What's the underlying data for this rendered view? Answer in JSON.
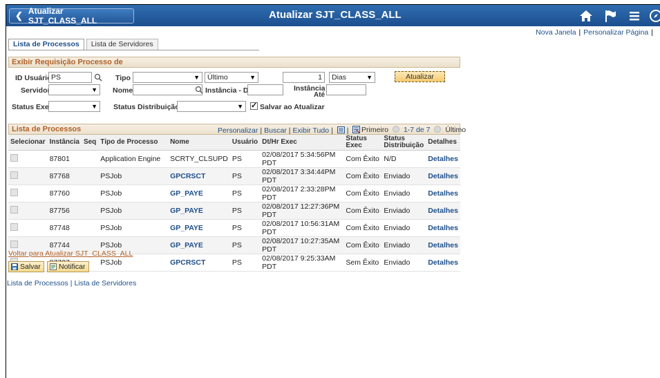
{
  "header": {
    "back_label": "Atualizar SJT_CLASS_ALL",
    "title": "Atualizar SJT_CLASS_ALL"
  },
  "top_links": {
    "new_window": "Nova Janela",
    "personalize": "Personalizar Página"
  },
  "tabs": [
    {
      "label": "Lista de Processos",
      "active": true
    },
    {
      "label": "Lista de Servidores",
      "active": false
    }
  ],
  "request": {
    "section_title": "Exibir Requisição Processo de",
    "user_id_label": "ID Usuário",
    "user_id_value": "PS",
    "type_label": "Tipo",
    "type_value": "",
    "last_value": "Último",
    "count_value": "1",
    "unit_value": "Dias",
    "refresh_label": "Atualizar",
    "server_label": "Servidor",
    "server_value": "",
    "name_label": "Nome",
    "name_value": "",
    "instance_from_label": "Instância - De",
    "instance_from_value": "",
    "instance_to_label_1": "Instância -",
    "instance_to_label_2": "Até",
    "instance_to_value": "",
    "run_status_label": "Status Exec",
    "run_status_value": "",
    "dist_status_label": "Status Distribuição",
    "dist_status_value": "",
    "save_on_refresh_label": "Salvar ao Atualizar",
    "save_on_refresh_checked": true
  },
  "grid": {
    "title": "Lista de Processos",
    "link_personalize": "Personalizar",
    "link_find": "Buscar",
    "link_view_all": "Exibir Tudo",
    "nav_first": "Primeiro",
    "nav_range": "1-7 de 7",
    "nav_last": "Último",
    "columns": [
      "Selecionar",
      "Instância",
      "Seq",
      "Tipo de Processo",
      "Nome",
      "Usuário",
      "Dt/Hr Exec",
      "Status Exec",
      "Status Distribuição",
      "Detalhes"
    ],
    "rows": [
      {
        "instance": "87801",
        "seq": "",
        "type": "Application Engine",
        "name": "SCRTY_CLSUPD",
        "name_link": false,
        "user": "PS",
        "datetime": "02/08/2017  5:34:56PM PDT",
        "run_status": "Com Êxito",
        "dist_status": "N/D",
        "details": "Detalhes"
      },
      {
        "instance": "87768",
        "seq": "",
        "type": "PSJob",
        "name": "GPCRSCT",
        "name_link": true,
        "user": "PS",
        "datetime": "02/08/2017  3:34:44PM PDT",
        "run_status": "Com Êxito",
        "dist_status": "Enviado",
        "details": "Detalhes"
      },
      {
        "instance": "87760",
        "seq": "",
        "type": "PSJob",
        "name": "GP_PAYE",
        "name_link": true,
        "user": "PS",
        "datetime": "02/08/2017  2:33:28PM PDT",
        "run_status": "Com Êxito",
        "dist_status": "Enviado",
        "details": "Detalhes"
      },
      {
        "instance": "87756",
        "seq": "",
        "type": "PSJob",
        "name": "GP_PAYE",
        "name_link": true,
        "user": "PS",
        "datetime": "02/08/2017 12:27:36PM PDT",
        "run_status": "Com Êxito",
        "dist_status": "Enviado",
        "details": "Detalhes"
      },
      {
        "instance": "87748",
        "seq": "",
        "type": "PSJob",
        "name": "GP_PAYE",
        "name_link": true,
        "user": "PS",
        "datetime": "02/08/2017 10:56:31AM PDT",
        "run_status": "Com Êxito",
        "dist_status": "Enviado",
        "details": "Detalhes"
      },
      {
        "instance": "87744",
        "seq": "",
        "type": "PSJob",
        "name": "GP_PAYE",
        "name_link": true,
        "user": "PS",
        "datetime": "02/08/2017 10:27:35AM PDT",
        "run_status": "Com Êxito",
        "dist_status": "Enviado",
        "details": "Detalhes"
      },
      {
        "instance": "87737",
        "seq": "",
        "type": "PSJob",
        "name": "GPCRSCT",
        "name_link": true,
        "user": "PS",
        "datetime": "02/08/2017  9:25:33AM PDT",
        "run_status": "Sem Êxito",
        "dist_status": "Enviado",
        "details": "Detalhes"
      }
    ]
  },
  "footer": {
    "back_link": "Voltar para Atualizar SJT_CLASS_ALL",
    "save_label": "Salvar",
    "notify_label": "Notificar",
    "link_process_list": "Lista de Processos",
    "link_server_list": "Lista de Servidores"
  },
  "colors": {
    "header_blue": "#1c4f8f",
    "section_text": "#b0622a",
    "link_blue": "#1e4f8a"
  }
}
